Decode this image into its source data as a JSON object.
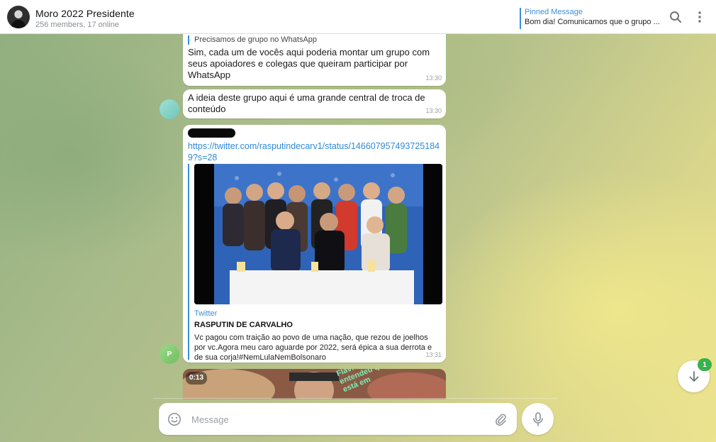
{
  "header": {
    "title": "Moro 2022 Presidente",
    "subtitle": "256 members, 17 online",
    "pinned_label": "Pinned Message",
    "pinned_text": "Bom dia! Comunicamos que o grupo ...",
    "search_icon": "search-icon",
    "more_icon": "more-vertical-icon"
  },
  "messages": [
    {
      "reply_to": "Precisamos de grupo no WhatsApp",
      "text": "Sim, cada um de vocês aqui poderia montar um grupo com seus apoiadores e colegas que queiram participar por WhatsApp",
      "time": "13:30"
    },
    {
      "text": "A ideia deste grupo aqui é uma grande central de troca de conteúdo",
      "time": "13:30"
    },
    {
      "link": "https://twitter.com/rasputindecarv1/status/1466079574937251849?s=28",
      "preview_site": "Twitter",
      "preview_title": "RASPUTIN DE CARVALHO",
      "preview_desc": "Vc pagou com traição ao povo de uma nação, que rezou de joelhos por vc.Agora meu caro aguarde por 2022, será épica a sua derrota e de sua corja!#NemLulaNemBolsonaro",
      "time": "13:31",
      "avatar_initial": "P"
    },
    {
      "video_duration": "0:13",
      "overlay_text": "Flávio não entendeu que está em"
    }
  ],
  "composer": {
    "placeholder": "Message",
    "emoji_icon": "smiley-icon",
    "attach_icon": "paperclip-icon",
    "mic_icon": "microphone-icon"
  },
  "scroll_down": {
    "icon": "arrow-down-icon",
    "unread_count": "1"
  },
  "colors": {
    "accent": "#3a8fd9",
    "badge": "#37b24d"
  }
}
